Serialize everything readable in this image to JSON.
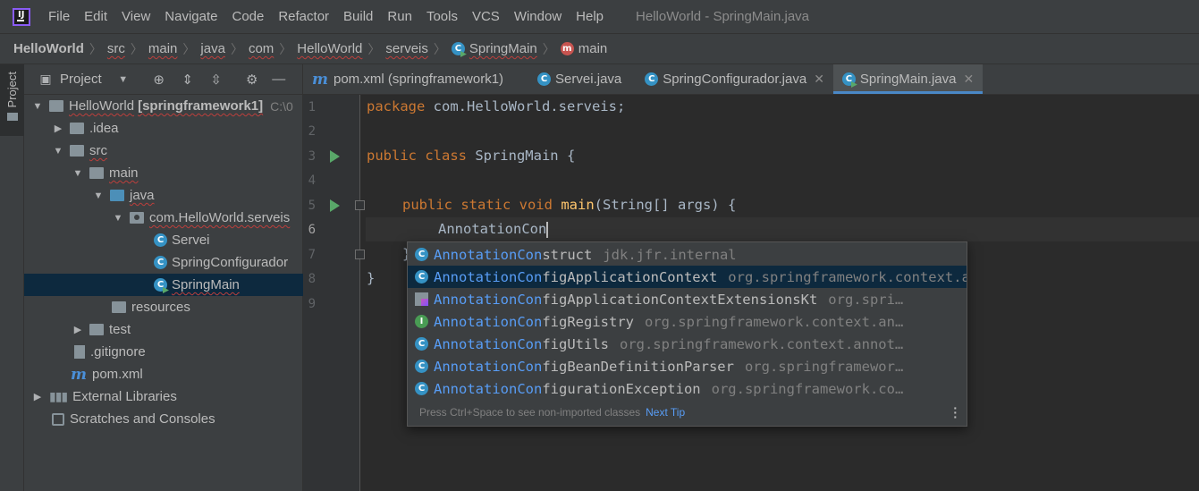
{
  "menubar": {
    "items": [
      "File",
      "Edit",
      "View",
      "Navigate",
      "Code",
      "Refactor",
      "Build",
      "Run",
      "Tools",
      "VCS",
      "Window",
      "Help"
    ],
    "window_title": "HelloWorld - SpringMain.java"
  },
  "breadcrumb": [
    "HelloWorld",
    "src",
    "main",
    "java",
    "com",
    "HelloWorld",
    "serveis",
    "SpringMain",
    "main"
  ],
  "side_tab": {
    "label": "Project"
  },
  "project_panel": {
    "title": "Project",
    "tree": [
      {
        "label": "HelloWorld",
        "suffix": "[springframework1]",
        "path": "C:\\0"
      },
      {
        "label": ".idea"
      },
      {
        "label": "src"
      },
      {
        "label": "main"
      },
      {
        "label": "java"
      },
      {
        "label": "com.HelloWorld.serveis"
      },
      {
        "label": "Servei"
      },
      {
        "label": "SpringConfigurador"
      },
      {
        "label": "SpringMain"
      },
      {
        "label": "resources"
      },
      {
        "label": "test"
      },
      {
        "label": ".gitignore"
      },
      {
        "label": "pom.xml"
      },
      {
        "label": "External Libraries"
      },
      {
        "label": "Scratches and Consoles"
      }
    ]
  },
  "editor": {
    "tabs": [
      {
        "label": "pom.xml (springframework1)"
      },
      {
        "label": "Servei.java"
      },
      {
        "label": "SpringConfigurador.java"
      },
      {
        "label": "SpringMain.java"
      }
    ],
    "line_numbers": [
      "1",
      "2",
      "3",
      "4",
      "5",
      "6",
      "7",
      "8",
      "9"
    ],
    "code": {
      "l1_kw": "package",
      "l1_rest": " com.HelloWorld.serveis;",
      "l3_kw": "public class",
      "l3_rest": " SpringMain {",
      "l5_kw": "public static void",
      "l5_fn": "main",
      "l5_rest": "(String[] args) {",
      "l6_text": "AnnotationCon",
      "l7_text": "}",
      "l8_text": "}"
    }
  },
  "completion": {
    "match": "AnnotationCon",
    "items": [
      {
        "rest": "struct",
        "package": "jdk.jfr.internal"
      },
      {
        "rest": "figApplicationContext",
        "package": "org.springframework.context.annotation"
      },
      {
        "rest": "figApplicationContextExtensionsKt",
        "package": "org.spri…"
      },
      {
        "rest": "figRegistry",
        "package": "org.springframework.context.an…"
      },
      {
        "rest": "figUtils",
        "package": "org.springframework.context.annot…"
      },
      {
        "rest": "figBeanDefinitionParser",
        "package": "org.springframewor…"
      },
      {
        "rest": "figurationException",
        "package": "org.springframework.co…"
      }
    ],
    "footer_hint": "Press Ctrl+Space to see non-imported classes",
    "footer_link": "Next Tip"
  }
}
